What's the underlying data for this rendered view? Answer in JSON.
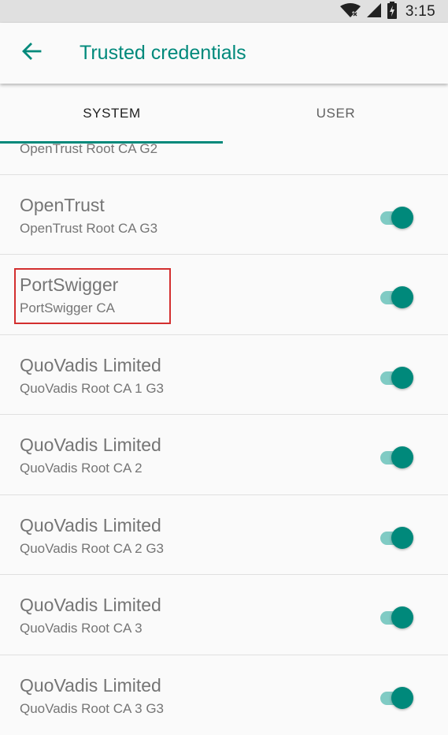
{
  "status_bar": {
    "time": "3:15",
    "icons": [
      "wifi-no-internet-icon",
      "cellular-signal-icon",
      "battery-charging-icon"
    ]
  },
  "app_bar": {
    "back_icon": "arrow-back-icon",
    "title": "Trusted credentials"
  },
  "tabs": [
    {
      "label": "SYSTEM",
      "selected": true
    },
    {
      "label": "USER",
      "selected": false
    }
  ],
  "credentials": [
    {
      "title": "",
      "subtitle": "OpenTrust Root CA G2",
      "enabled": true
    },
    {
      "title": "OpenTrust",
      "subtitle": "OpenTrust Root CA G3",
      "enabled": true
    },
    {
      "title": "PortSwigger",
      "subtitle": "PortSwigger CA",
      "enabled": true,
      "highlighted": true
    },
    {
      "title": "QuoVadis Limited",
      "subtitle": "QuoVadis Root CA 1 G3",
      "enabled": true
    },
    {
      "title": "QuoVadis Limited",
      "subtitle": "QuoVadis Root CA 2",
      "enabled": true
    },
    {
      "title": "QuoVadis Limited",
      "subtitle": "QuoVadis Root CA 2 G3",
      "enabled": true
    },
    {
      "title": "QuoVadis Limited",
      "subtitle": "QuoVadis Root CA 3",
      "enabled": true
    },
    {
      "title": "QuoVadis Limited",
      "subtitle": "QuoVadis Root CA 3 G3",
      "enabled": true
    }
  ],
  "colors": {
    "accent": "#00897b",
    "switch_track": "#80cbc4",
    "highlight": "#d32f2f",
    "status_bar_bg": "#e0e0e0"
  }
}
